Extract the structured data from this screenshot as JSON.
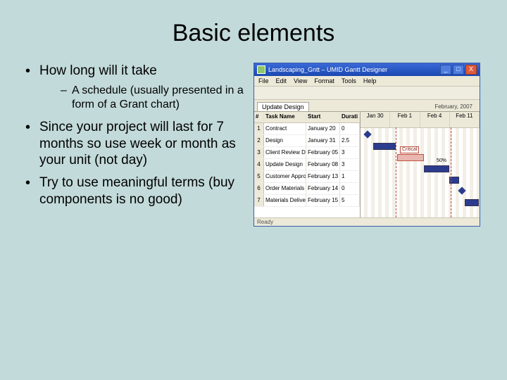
{
  "title": "Basic elements",
  "bullets": {
    "b1": "How long will it take",
    "b1a": "A schedule (usually presented in a form of a Grant chart)",
    "b2": "Since your project will last for 7 months so use week or month as your unit (not day)",
    "b3": "Try to use meaningful terms (buy components is no good)"
  },
  "win": {
    "title": "Landscaping_Gntt – UMID Gantt Designer",
    "min": "_",
    "max": "□",
    "close": "X"
  },
  "menu": [
    "File",
    "Edit",
    "View",
    "Format",
    "Tools",
    "Help"
  ],
  "tab": "Update Design",
  "monthlabel": "February, 2007",
  "cols": {
    "num": "#",
    "task": "Task Name",
    "start": "Start",
    "dur": "Durati\non"
  },
  "rows": [
    {
      "n": "1",
      "task": "Contract",
      "start": "January 20",
      "dur": "0"
    },
    {
      "n": "2",
      "task": "Design",
      "start": "January 31",
      "dur": "2.5"
    },
    {
      "n": "3",
      "task": "Client Review Design",
      "start": "February 05",
      "dur": "3"
    },
    {
      "n": "4",
      "task": "Update Design",
      "start": "February 08",
      "dur": "3"
    },
    {
      "n": "5",
      "task": "Customer Approval",
      "start": "February 13",
      "dur": "1"
    },
    {
      "n": "6",
      "task": "Order Materials",
      "start": "February 14",
      "dur": "0"
    },
    {
      "n": "7",
      "task": "Materials Delivery",
      "start": "February 15",
      "dur": "5"
    }
  ],
  "timeline": [
    "Jan 30",
    "Feb 1",
    "Feb 4",
    "Feb 11"
  ],
  "labels": {
    "critical": "Critical",
    "pct50": "50%"
  },
  "status": "Ready"
}
